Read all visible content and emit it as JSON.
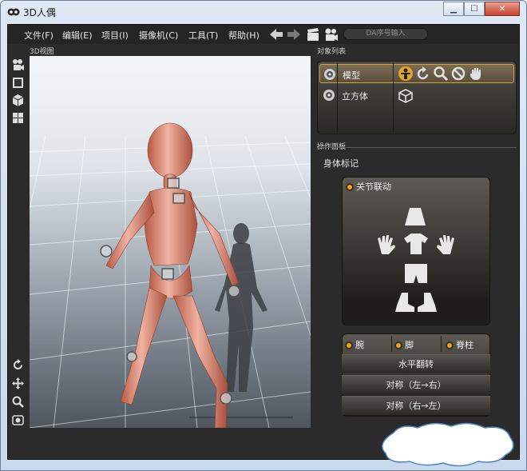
{
  "window": {
    "title": "3D人偶"
  },
  "menu": [
    "文件(F)",
    "编辑(E)",
    "项目(I)",
    "摄像机(C)",
    "工具(T)",
    "帮助(H)"
  ],
  "da_input": {
    "placeholder": "DA序号输入"
  },
  "labels": {
    "viewport": "3D视图",
    "object_list": "对象列表",
    "operation_panel": "操作面板",
    "body_mark": "身体标记"
  },
  "objects": [
    {
      "name": "模型",
      "selected": true
    },
    {
      "name": "立方体",
      "selected": false
    }
  ],
  "linkage": {
    "label": "关节联动"
  },
  "options": [
    "腕",
    "脚",
    "脊柱"
  ],
  "actions": [
    "水平翻转",
    "对称（左→右）",
    "对称（右→左）"
  ],
  "colors": {
    "accent": "#e5a52a",
    "panel": "#2b2b2b",
    "skin": "#d9866e"
  }
}
